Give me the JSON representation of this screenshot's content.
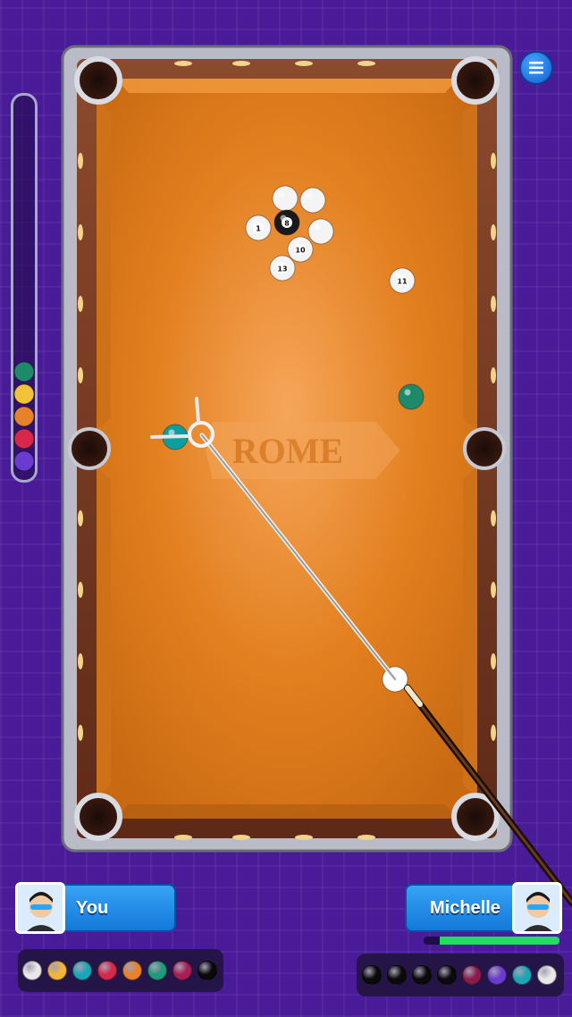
{
  "table": {
    "theme_label": "ROME",
    "felt_color": "#e07a17",
    "rail_color": "#7a3a22"
  },
  "players": {
    "you": {
      "name": "You"
    },
    "opponent": {
      "name": "Michelle",
      "timer_fraction": 0.88
    }
  },
  "balls_on_table": [
    {
      "number": "",
      "color": "#1f8a6a",
      "stripe": false
    },
    {
      "number": "",
      "color": "#6a3bd0",
      "stripe": true
    },
    {
      "number": "",
      "color": "#8a1b4a",
      "stripe": true
    },
    {
      "number": "1",
      "color": "#f2c33a",
      "stripe": true
    },
    {
      "number": "8",
      "color": "#1a1a1a",
      "stripe": false
    },
    {
      "number": "",
      "color": "#a81d55",
      "stripe": true
    },
    {
      "number": "10",
      "color": "#1a9ab8",
      "stripe": true
    },
    {
      "number": "13",
      "color": "#e8822a",
      "stripe": true
    },
    {
      "number": "11",
      "color": "#d8284a",
      "stripe": true
    },
    {
      "number": "",
      "color": "#0f9ea0",
      "stripe": false
    },
    {
      "number": "",
      "color": "#ffffff",
      "stripe": false
    }
  ],
  "potted_rack": [
    {
      "color": "#1f8a6a"
    },
    {
      "color": "#f2c33a"
    },
    {
      "color": "#e8822a"
    },
    {
      "color": "#d8284a"
    },
    {
      "color": "#6a3bd0"
    }
  ],
  "you_balls": [
    {
      "color": "#e8e8e8"
    },
    {
      "color": "#f2b53a"
    },
    {
      "color": "#1aa6b8"
    },
    {
      "color": "#d8284a"
    },
    {
      "color": "#e8822a"
    },
    {
      "color": "#1f9a7a"
    },
    {
      "color": "#a81d55"
    },
    {
      "color": "#0a0a0a"
    }
  ],
  "opponent_balls": [
    {
      "color": "#0a0a0a"
    },
    {
      "color": "#0a0a0a"
    },
    {
      "color": "#0a0a0a"
    },
    {
      "color": "#0a0a0a"
    },
    {
      "color": "#8a1b4a"
    },
    {
      "color": "#6a3bd0"
    },
    {
      "color": "#1aa6b8"
    },
    {
      "color": "#e8e8e8"
    }
  ],
  "icons": {
    "menu": "hamburger-menu-icon",
    "cue": "cue-stick-icon",
    "aim": "aim-guide-icon"
  }
}
